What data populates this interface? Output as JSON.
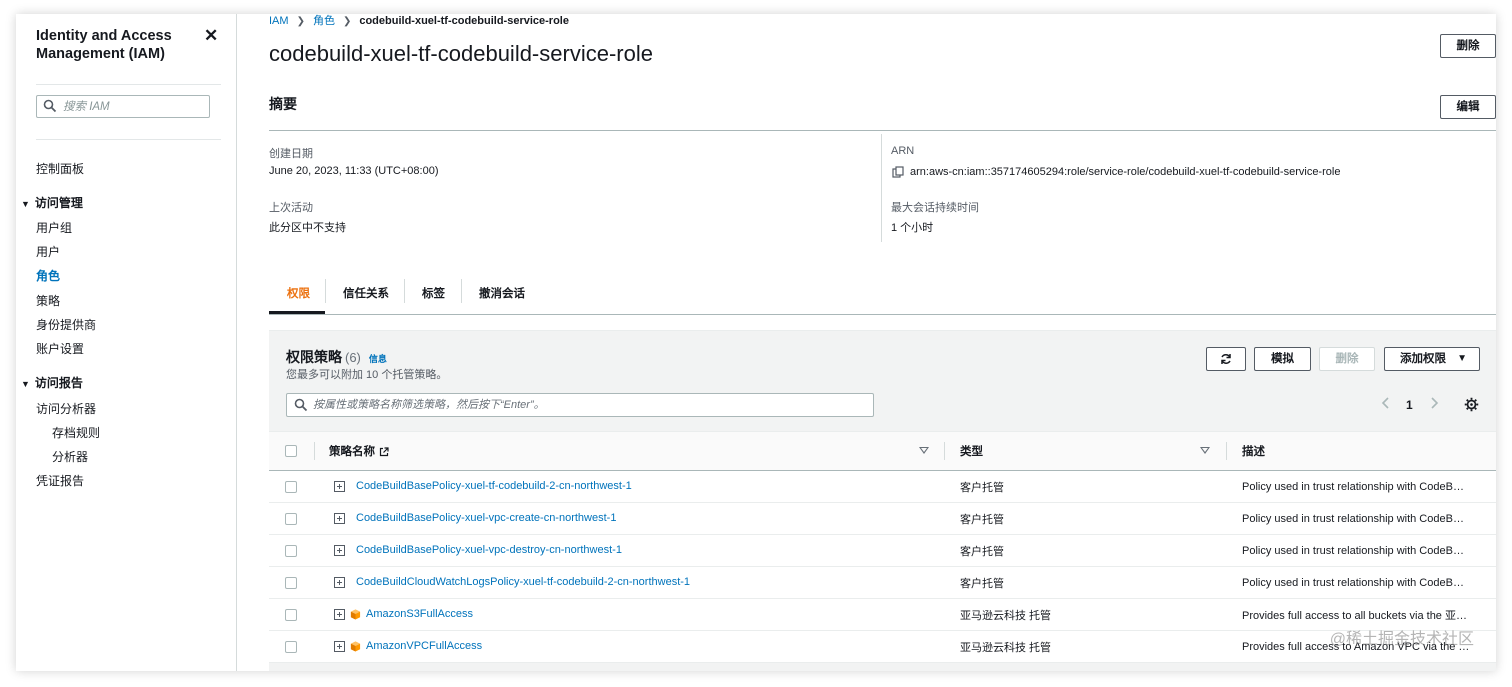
{
  "sidebar": {
    "title": "Identity and Access Management (IAM)",
    "search_placeholder": "搜索 IAM",
    "dashboard": "控制面板",
    "access_mgmt": {
      "label": "访问管理",
      "items": [
        "用户组",
        "用户",
        "角色",
        "策略",
        "身份提供商",
        "账户设置"
      ],
      "active": "角色"
    },
    "access_reports": {
      "label": "访问报告",
      "analyzer": "访问分析器",
      "sub": [
        "存档规则",
        "分析器"
      ],
      "credential": "凭证报告"
    }
  },
  "breadcrumb": {
    "iam": "IAM",
    "roles": "角色",
    "current": "codebuild-xuel-tf-codebuild-service-role"
  },
  "page_title": "codebuild-xuel-tf-codebuild-service-role",
  "buttons": {
    "delete": "删除",
    "edit": "编辑",
    "simulate": "模拟",
    "remove": "删除",
    "add_permissions": "添加权限"
  },
  "summary": {
    "title": "摘要",
    "created_label": "创建日期",
    "created_value": "June 20, 2023, 11:33 (UTC+08:00)",
    "last_activity_label": "上次活动",
    "last_activity_value": "此分区中不支持",
    "arn_label": "ARN",
    "arn_value": "arn:aws-cn:iam::357174605294:role/service-role/codebuild-xuel-tf-codebuild-service-role",
    "max_session_label": "最大会话持续时间",
    "max_session_value": "1 个小时"
  },
  "tabs": [
    "权限",
    "信任关系",
    "标签",
    "撤消会话"
  ],
  "policies": {
    "title": "权限策略",
    "count": "(6)",
    "info": "信息",
    "subtitle": "您最多可以附加 10 个托管策略。",
    "search_placeholder": "按属性或策略名称筛选策略，然后按下“Enter”。",
    "page": "1",
    "columns": [
      "策略名称",
      "类型",
      "描述"
    ],
    "rows": [
      {
        "name": "CodeBuildBasePolicy-xuel-tf-codebuild-2-cn-northwest-1",
        "type": "客户托管",
        "desc": "Policy used in trust relationship with CodeB…",
        "aws": false
      },
      {
        "name": "CodeBuildBasePolicy-xuel-vpc-create-cn-northwest-1",
        "type": "客户托管",
        "desc": "Policy used in trust relationship with CodeB…",
        "aws": false
      },
      {
        "name": "CodeBuildBasePolicy-xuel-vpc-destroy-cn-northwest-1",
        "type": "客户托管",
        "desc": "Policy used in trust relationship with CodeB…",
        "aws": false
      },
      {
        "name": "CodeBuildCloudWatchLogsPolicy-xuel-tf-codebuild-2-cn-northwest-1",
        "type": "客户托管",
        "desc": "Policy used in trust relationship with CodeB…",
        "aws": false
      },
      {
        "name": "AmazonS3FullAccess",
        "type": "亚马逊云科技 托管",
        "desc": "Provides full access to all buckets via the 亚…",
        "aws": true
      },
      {
        "name": "AmazonVPCFullAccess",
        "type": "亚马逊云科技 托管",
        "desc": "Provides full access to Amazon VPC via the …",
        "aws": true
      }
    ]
  },
  "watermark": "@稀土掘金技术社区",
  "colors": {
    "link": "#0073bb",
    "active_tab": "#ec7211",
    "aws_icon": "#f90"
  }
}
